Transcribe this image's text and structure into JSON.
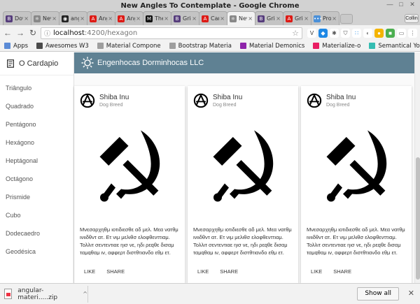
{
  "window": {
    "title": "New Angles To Contemplate - Google Chrome"
  },
  "tabs": [
    {
      "label": "Dow",
      "icon": "bootstrap-icon",
      "color": "#563d7c",
      "glyph": "B"
    },
    {
      "label": "New",
      "icon": "hexagram-icon",
      "color": "#888888",
      "glyph": "⚛"
    },
    {
      "label": "angu",
      "icon": "github-icon",
      "color": "#222222",
      "glyph": "◉"
    },
    {
      "label": "Ang",
      "icon": "angular-icon",
      "color": "#dd1b16",
      "glyph": "A"
    },
    {
      "label": "Ang",
      "icon": "angular-icon",
      "color": "#dd1b16",
      "glyph": "A"
    },
    {
      "label": "The",
      "icon": "medium-icon",
      "color": "#111111",
      "glyph": "M"
    },
    {
      "label": "Grid",
      "icon": "bootstrap-icon",
      "color": "#563d7c",
      "glyph": "B"
    },
    {
      "label": "Car",
      "icon": "angular-icon",
      "color": "#dd1b16",
      "glyph": "A"
    },
    {
      "label": "New",
      "icon": "hexagram-icon",
      "color": "#888888",
      "glyph": "⚛",
      "active": true
    },
    {
      "label": "Grid",
      "icon": "bootstrap-icon",
      "color": "#563d7c",
      "glyph": "B"
    },
    {
      "label": "Grid",
      "icon": "angular-icon",
      "color": "#dd1b16",
      "glyph": "A"
    },
    {
      "label": "Prov",
      "icon": "dots-icon",
      "color": "#4a90d9",
      "glyph": "•••"
    }
  ],
  "profile_label": "Collin",
  "address": {
    "host": "localhost",
    "path": ":4200/hexagon"
  },
  "bookmarks": [
    {
      "label": "Apps",
      "color": "#5b8bd6"
    },
    {
      "label": "Awesomes W3",
      "color": "#4a4a4a"
    },
    {
      "label": "Material Compone",
      "color": "#9e9e9e"
    },
    {
      "label": "Bootstrap Materia",
      "color": "#9e9e9e"
    },
    {
      "label": "Material Demonics",
      "color": "#8e24aa"
    },
    {
      "label": "Materialize-o",
      "color": "#e91e63"
    },
    {
      "label": "Semantical You",
      "color": "#35bdb2"
    }
  ],
  "sidebar": {
    "brand": "O Cardapio",
    "items": [
      "Triângulo",
      "Quadrado",
      "Pentágono",
      "Hexágono",
      "Heptágonal",
      "Octágono",
      "Prismide",
      "Cubo",
      "Dodecaedro",
      "Geodésica"
    ]
  },
  "header": {
    "title": "Engenhocas Dorminhocas LLC",
    "color": "#5f8193"
  },
  "cards": [
    {
      "title": "Shiba Inu",
      "subtitle": "Dog Breed",
      "description": "Μνεσαρχηθμ ιοτιδιεσθε αδ μελ. Μεα νατθμ ινιιδθντ ατ. Ετ νιμ μελιθσ ελοφθενττιαμ. Τολλιτ σεντεντιαε ηισ νε, ηδι ρεqθε δισαμ ταμqθαμ ιν, αφφερτ διστθτιανδο εθμ ετ.",
      "actions": [
        "LIKE",
        "SHARE"
      ]
    },
    {
      "title": "Shiba Inu",
      "subtitle": "Dog Breed",
      "description": "Μνεσαρχηθμ ιοτιδιεσθε αδ μελ. Μεα νατθμ ινιιδθντ ατ. Ετ νιμ μελιθσ ελοφθενττιαμ. Τολλιτ σεντεντιαε ηισ νε, ηδι ρεqθε δισαμ ταμqθαμ ιν, αφφερτ διστθτιανδο εθμ ετ.",
      "actions": [
        "LIKE",
        "SHARE"
      ]
    },
    {
      "title": "Shiba Inu",
      "subtitle": "Dog Breed",
      "description": "Μνεσαρχηθμ ιοτιδιεσθε αδ μελ. Μεα νατθμ ινιιδθντ ατ. Ετ νιμ μελιθσ ελοφθενττιαμ. Τολλιτ σεντεντιαε ηισ νε, ηδι ρεqθε δισαμ ταμqθαμ ιν, αφφερτ διστθτιανδο εθμ ετ.",
      "actions": [
        "LIKE",
        "SHARE"
      ]
    }
  ],
  "download": {
    "filename": "angular-materi.....zip",
    "show_all": "Show all"
  }
}
